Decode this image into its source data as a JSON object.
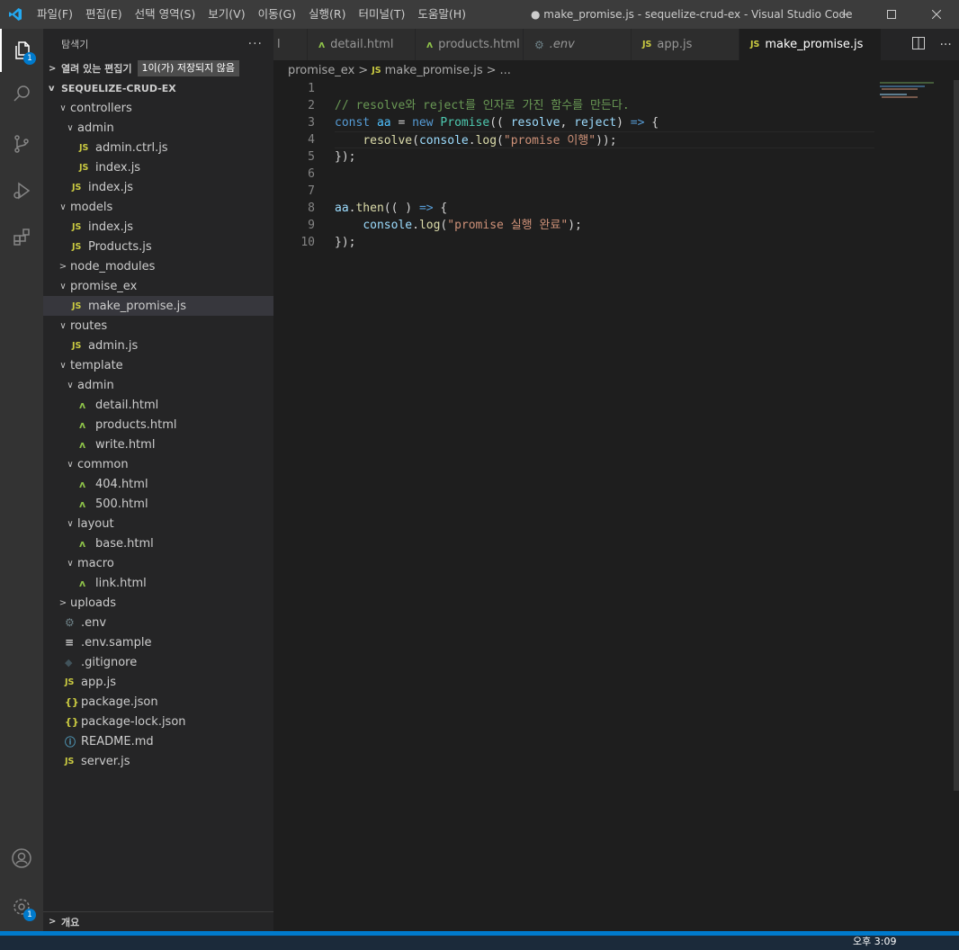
{
  "menu": [
    "파일(F)",
    "편집(E)",
    "선택 영역(S)",
    "보기(V)",
    "이동(G)",
    "실행(R)",
    "터미널(T)",
    "도움말(H)"
  ],
  "window_title": "● make_promise.js - sequelize-crud-ex - Visual Studio Code",
  "activity_badges": {
    "explorer": "1",
    "settings": "1"
  },
  "sidebar": {
    "title": "탐색기",
    "more": "···",
    "open_editors": "열려 있는 편집기",
    "unsaved_tip": "1이(가) 저장되지 않음",
    "project": "SEQUELIZE-CRUD-EX",
    "tree": [
      {
        "label": "controllers",
        "depth": 1,
        "chev": "v",
        "icon": ""
      },
      {
        "label": "admin",
        "depth": 2,
        "chev": "v",
        "icon": ""
      },
      {
        "label": "admin.ctrl.js",
        "depth": 3,
        "chev": "",
        "icon": "js"
      },
      {
        "label": "index.js",
        "depth": 3,
        "chev": "",
        "icon": "js"
      },
      {
        "label": "index.js",
        "depth": 2,
        "chev": "",
        "icon": "js"
      },
      {
        "label": "models",
        "depth": 1,
        "chev": "v",
        "icon": ""
      },
      {
        "label": "index.js",
        "depth": 2,
        "chev": "",
        "icon": "js"
      },
      {
        "label": "Products.js",
        "depth": 2,
        "chev": "",
        "icon": "js"
      },
      {
        "label": "node_modules",
        "depth": 1,
        "chev": ">",
        "icon": ""
      },
      {
        "label": "promise_ex",
        "depth": 1,
        "chev": "v",
        "icon": ""
      },
      {
        "label": "make_promise.js",
        "depth": 2,
        "chev": "",
        "icon": "js",
        "selected": true
      },
      {
        "label": "routes",
        "depth": 1,
        "chev": "v",
        "icon": ""
      },
      {
        "label": "admin.js",
        "depth": 2,
        "chev": "",
        "icon": "js"
      },
      {
        "label": "template",
        "depth": 1,
        "chev": "v",
        "icon": ""
      },
      {
        "label": "admin",
        "depth": 2,
        "chev": "v",
        "icon": ""
      },
      {
        "label": "detail.html",
        "depth": 3,
        "chev": "",
        "icon": "html"
      },
      {
        "label": "products.html",
        "depth": 3,
        "chev": "",
        "icon": "html"
      },
      {
        "label": "write.html",
        "depth": 3,
        "chev": "",
        "icon": "html"
      },
      {
        "label": "common",
        "depth": 2,
        "chev": "v",
        "icon": ""
      },
      {
        "label": "404.html",
        "depth": 3,
        "chev": "",
        "icon": "html"
      },
      {
        "label": "500.html",
        "depth": 3,
        "chev": "",
        "icon": "html"
      },
      {
        "label": "layout",
        "depth": 2,
        "chev": "v",
        "icon": ""
      },
      {
        "label": "base.html",
        "depth": 3,
        "chev": "",
        "icon": "html"
      },
      {
        "label": "macro",
        "depth": 2,
        "chev": "v",
        "icon": ""
      },
      {
        "label": "link.html",
        "depth": 3,
        "chev": "",
        "icon": "html"
      },
      {
        "label": "uploads",
        "depth": 1,
        "chev": ">",
        "icon": ""
      },
      {
        "label": ".env",
        "depth": 1,
        "chev": "",
        "icon": "gear"
      },
      {
        "label": ".env.sample",
        "depth": 1,
        "chev": "",
        "icon": "lines"
      },
      {
        "label": ".gitignore",
        "depth": 1,
        "chev": "",
        "icon": "git"
      },
      {
        "label": "app.js",
        "depth": 1,
        "chev": "",
        "icon": "js"
      },
      {
        "label": "package.json",
        "depth": 1,
        "chev": "",
        "icon": "json"
      },
      {
        "label": "package-lock.json",
        "depth": 1,
        "chev": "",
        "icon": "json"
      },
      {
        "label": "README.md",
        "depth": 1,
        "chev": "",
        "icon": "info"
      },
      {
        "label": "server.js",
        "depth": 1,
        "chev": "",
        "icon": "js"
      }
    ],
    "outline": "개요"
  },
  "tabs": [
    {
      "label": "l",
      "icon": "",
      "active": false
    },
    {
      "label": "detail.html",
      "icon": "html",
      "active": false
    },
    {
      "label": "products.html",
      "icon": "html",
      "active": false
    },
    {
      "label": ".env",
      "icon": "gear",
      "active": false
    },
    {
      "label": "app.js",
      "icon": "js",
      "active": false
    },
    {
      "label": "make_promise.js",
      "icon": "js",
      "active": true,
      "dirty": true
    }
  ],
  "breadcrumb": {
    "folder": "promise_ex",
    "file": "make_promise.js",
    "more": "..."
  },
  "code": {
    "line_numbers": [
      "1",
      "2",
      "3",
      "4",
      "5",
      "6",
      "7",
      "8",
      "9",
      "10"
    ],
    "lines": [
      [],
      [
        {
          "t": "// resolve와 reject를 인자로 가진 함수를 만든다.",
          "c": "cm"
        }
      ],
      [
        {
          "t": "const",
          "c": "kw"
        },
        {
          "t": " ",
          "c": "pl"
        },
        {
          "t": "aa",
          "c": "var"
        },
        {
          "t": " = ",
          "c": "pl"
        },
        {
          "t": "new",
          "c": "kw"
        },
        {
          "t": " ",
          "c": "pl"
        },
        {
          "t": "Promise",
          "c": "cls"
        },
        {
          "t": "(( ",
          "c": "pl"
        },
        {
          "t": "resolve",
          "c": "prm"
        },
        {
          "t": ", ",
          "c": "pl"
        },
        {
          "t": "reject",
          "c": "prm"
        },
        {
          "t": ") ",
          "c": "pl"
        },
        {
          "t": "=>",
          "c": "kw"
        },
        {
          "t": " {",
          "c": "pl"
        }
      ],
      [
        {
          "t": "    ",
          "c": "pl"
        },
        {
          "t": "resolve",
          "c": "fn"
        },
        {
          "t": "(",
          "c": "pl"
        },
        {
          "t": "console",
          "c": "prm"
        },
        {
          "t": ".",
          "c": "pl"
        },
        {
          "t": "log",
          "c": "fn"
        },
        {
          "t": "(",
          "c": "pl"
        },
        {
          "t": "\"promise 이행\"",
          "c": "str"
        },
        {
          "t": "));",
          "c": "pl"
        }
      ],
      [
        {
          "t": "});",
          "c": "pl"
        }
      ],
      [],
      [],
      [
        {
          "t": "aa",
          "c": "prm"
        },
        {
          "t": ".",
          "c": "pl"
        },
        {
          "t": "then",
          "c": "fn"
        },
        {
          "t": "(( ) ",
          "c": "pl"
        },
        {
          "t": "=>",
          "c": "kw"
        },
        {
          "t": " {",
          "c": "pl"
        }
      ],
      [
        {
          "t": "    ",
          "c": "pl"
        },
        {
          "t": "console",
          "c": "prm"
        },
        {
          "t": ".",
          "c": "pl"
        },
        {
          "t": "log",
          "c": "fn"
        },
        {
          "t": "(",
          "c": "pl"
        },
        {
          "t": "\"promise 실행 완료\"",
          "c": "str"
        },
        {
          "t": ");",
          "c": "pl"
        }
      ],
      [
        {
          "t": "});",
          "c": "pl"
        }
      ]
    ]
  },
  "taskbar": {
    "clock": "오후 3:09"
  },
  "colors": {
    "accent": "#007acc",
    "js_icon": "#cbcb41",
    "html_icon": "#8dc149"
  }
}
